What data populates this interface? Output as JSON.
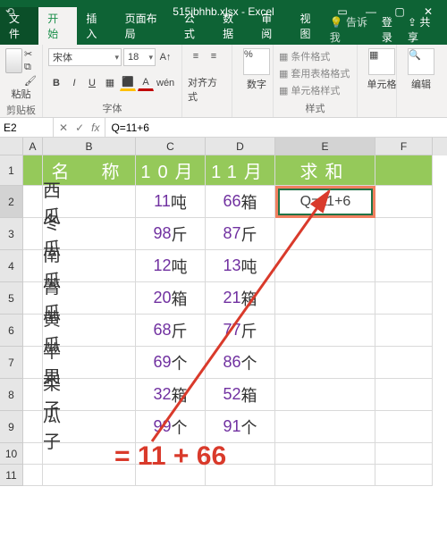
{
  "window": {
    "title": "515jbhhb.xlsx - Excel"
  },
  "file_tab": "文件",
  "tabs": [
    "开始",
    "插入",
    "页面布局",
    "公式",
    "数据",
    "审阅",
    "视图"
  ],
  "tell_me": "告诉我",
  "login": "登录",
  "share": "共享",
  "clipboard": {
    "label": "剪贴板",
    "paste": "粘贴"
  },
  "font": {
    "label": "字体",
    "family": "宋体",
    "size": "18",
    "bold": "B",
    "italic": "I",
    "underline": "U"
  },
  "align": {
    "label": "对齐方式"
  },
  "number": {
    "label": "数字"
  },
  "styles": {
    "label": "样式",
    "r1": "条件格式",
    "r2": "套用表格格式",
    "r3": "单元格样式"
  },
  "cells": {
    "label": "单元格"
  },
  "editing": {
    "label": "编辑"
  },
  "namebox": "E2",
  "formula": "Q=11+6",
  "columns": [
    "A",
    "B",
    "C",
    "D",
    "E",
    "F"
  ],
  "row_headers": [
    "1",
    "2",
    "3",
    "4",
    "5",
    "6",
    "7",
    "8",
    "9",
    "10",
    "11"
  ],
  "headers": {
    "B": "名　称",
    "C": "10月",
    "D": "11月",
    "E": "求和"
  },
  "rows": [
    {
      "name": "西　　瓜",
      "c_num": "11",
      "c_unit": "吨",
      "d_num": "66",
      "d_unit": "箱"
    },
    {
      "name": "冬　　瓜",
      "c_num": "98",
      "c_unit": "斤",
      "d_num": "87",
      "d_unit": "斤"
    },
    {
      "name": "南　　瓜",
      "c_num": "12",
      "c_unit": "吨",
      "d_num": "13",
      "d_unit": "吨"
    },
    {
      "name": "菁　　瓜",
      "c_num": "20",
      "c_unit": "箱",
      "d_num": "21",
      "d_unit": "箱"
    },
    {
      "name": "黄　　瓜",
      "c_num": "68",
      "c_unit": "斤",
      "d_num": "77",
      "d_unit": "斤"
    },
    {
      "name": "苹　　果",
      "c_num": "69",
      "c_unit": "个",
      "d_num": "86",
      "d_unit": "个"
    },
    {
      "name": "梨　　子",
      "c_num": "32",
      "c_unit": "箱",
      "d_num": "52",
      "d_unit": "箱"
    },
    {
      "name": "瓜　　子",
      "c_num": "99",
      "c_unit": "个",
      "d_num": "91",
      "d_unit": "个"
    }
  ],
  "e2_value": "Q=11+6",
  "annotation": "=  11 + 66"
}
